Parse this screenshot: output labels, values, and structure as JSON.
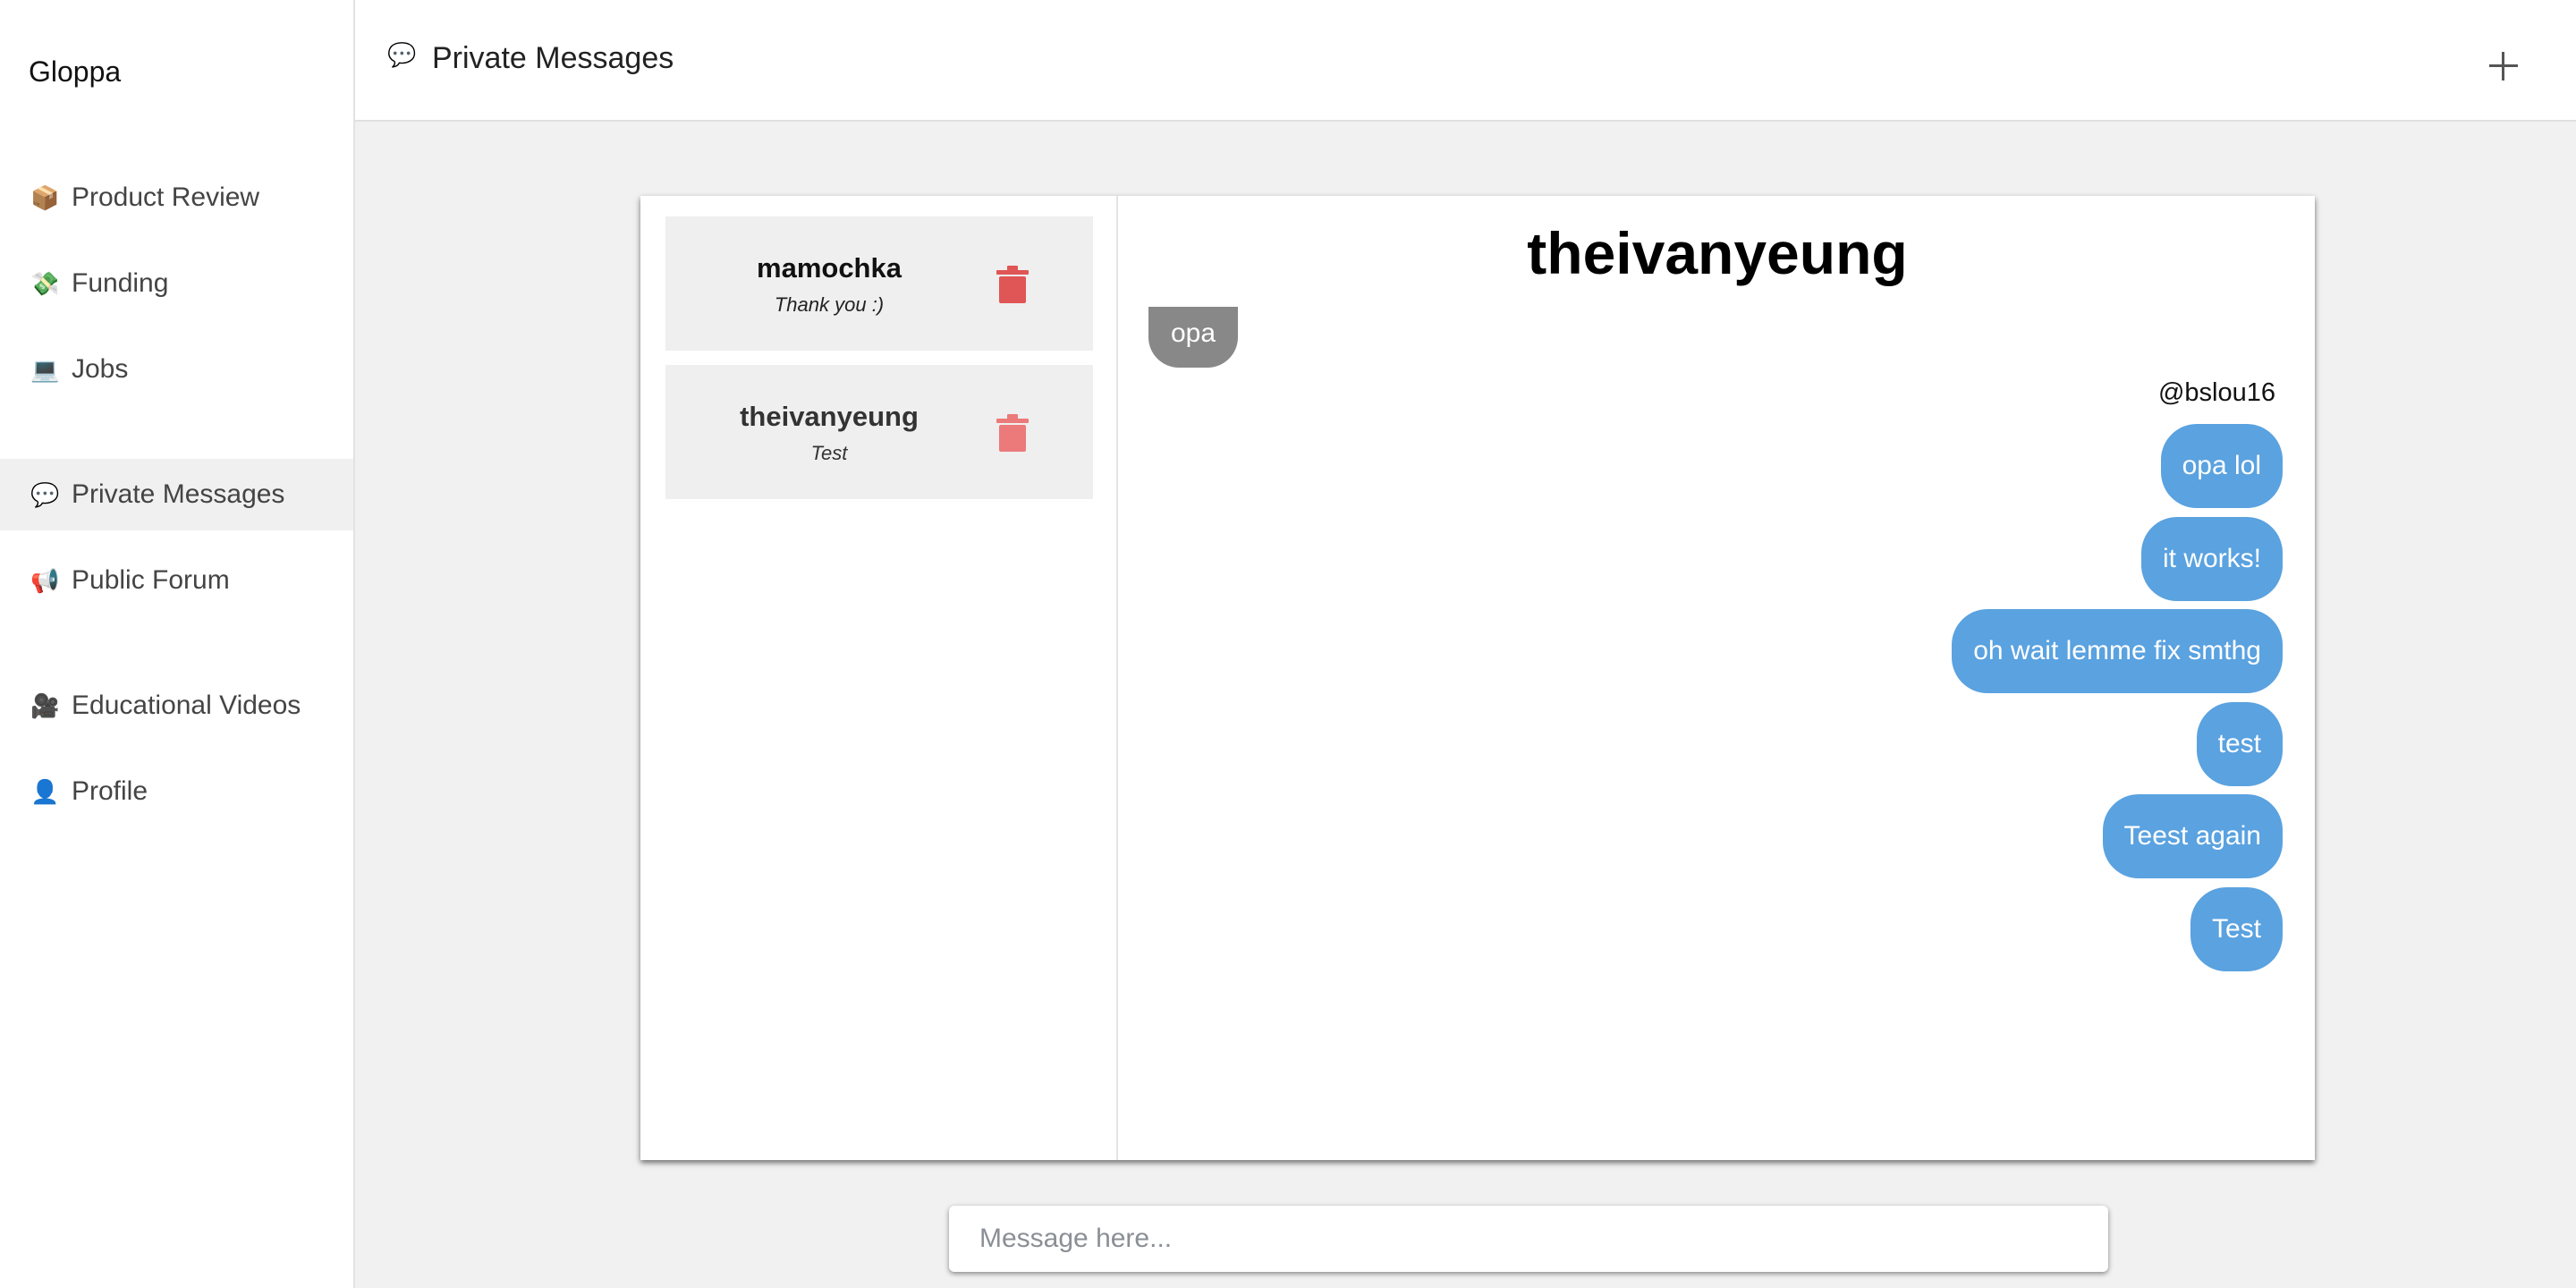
{
  "app": {
    "brand": "Gloppa"
  },
  "sidebar": {
    "items": [
      {
        "label": "Product Review",
        "icon": "📦",
        "icon_name": "package-icon"
      },
      {
        "label": "Funding",
        "icon": "💸",
        "icon_name": "money-icon"
      },
      {
        "label": "Jobs",
        "icon": "💻",
        "icon_name": "laptop-icon"
      },
      {
        "label": "Private Messages",
        "icon": "💬",
        "icon_name": "speech-bubble-icon",
        "active": true
      },
      {
        "label": "Public Forum",
        "icon": "📢",
        "icon_name": "megaphone-icon"
      },
      {
        "label": "Educational Videos",
        "icon": "🎥",
        "icon_name": "camera-icon"
      },
      {
        "label": "Profile",
        "icon": "👤",
        "icon_name": "user-icon"
      }
    ]
  },
  "header": {
    "title": "Private Messages",
    "icon": "💬",
    "icon_name": "speech-bubble-icon"
  },
  "conversations": [
    {
      "name": "mamochka",
      "preview": "Thank you :)"
    },
    {
      "name": "theivanyeung",
      "preview": "Test"
    }
  ],
  "thread": {
    "title": "theivanyeung",
    "incoming": [
      {
        "text": "opa"
      }
    ],
    "sender_label": "@bslou16",
    "outgoing": [
      {
        "text": "opa lol"
      },
      {
        "text": "it works!"
      },
      {
        "text": "oh wait lemme fix smthg"
      },
      {
        "text": "test"
      },
      {
        "text": "Teest again"
      },
      {
        "text": "Test"
      }
    ]
  },
  "composer": {
    "placeholder": "Message here..."
  },
  "colors": {
    "outgoing_bubble": "#5aa2e0",
    "incoming_bubble": "#888888",
    "trash": "#e05555",
    "active_nav": "#f0f0f0"
  }
}
